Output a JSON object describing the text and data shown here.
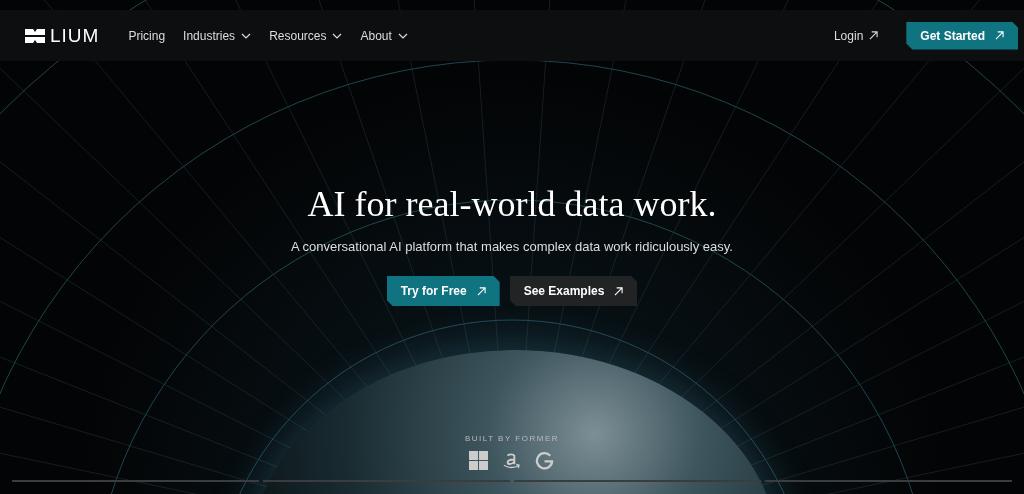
{
  "nav": {
    "logo": "LIUM",
    "links": [
      {
        "label": "Pricing",
        "dropdown": false
      },
      {
        "label": "Industries",
        "dropdown": true
      },
      {
        "label": "Resources",
        "dropdown": true
      },
      {
        "label": "About",
        "dropdown": true
      }
    ],
    "login": "Login",
    "cta": "Get Started"
  },
  "hero": {
    "title": "AI for real-world data work.",
    "subtitle": "A conversational AI platform that makes complex data work ridiculously easy.",
    "buttons": [
      {
        "label": "Try for Free",
        "kind": "primary"
      },
      {
        "label": "See Examples",
        "kind": "secondary"
      }
    ]
  },
  "built_by": {
    "label": "BUILT BY FORMER",
    "logos": [
      {
        "kind": "windows"
      },
      {
        "kind": "amazon"
      },
      {
        "kind": "google"
      }
    ]
  }
}
